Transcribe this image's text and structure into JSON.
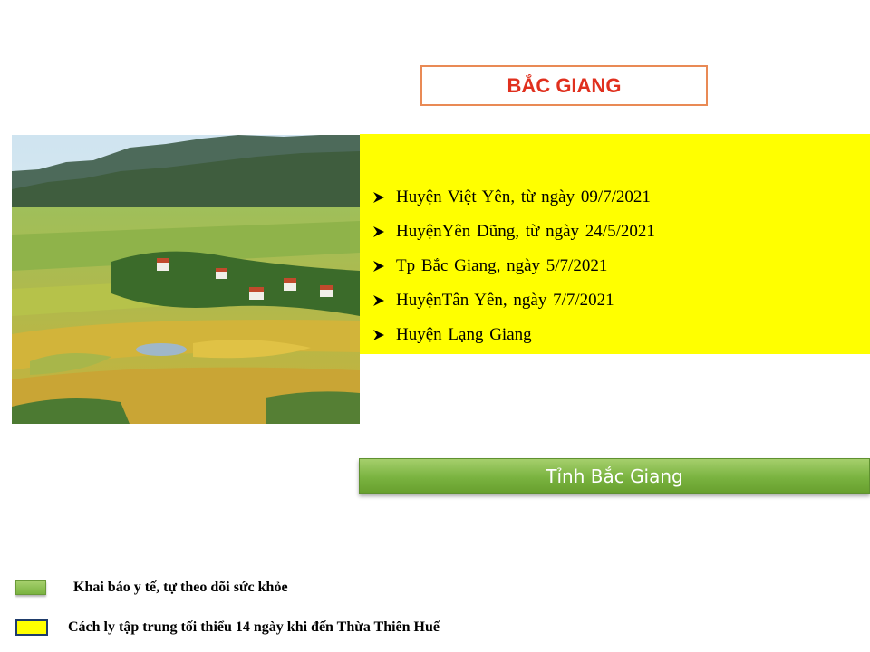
{
  "slide": {
    "title": "BẮC GIANG",
    "districts": [
      {
        "label": "Huyện  Việt Yên,  từ ngày  09/7/2021"
      },
      {
        "label": "HuyệnYên  Dũng,   từ ngày  24/5/2021"
      },
      {
        "label": "Tp Bắc Giang,  ngày  5/7/2021"
      },
      {
        "label": "HuyệnTân  Yên,  ngày  7/7/2021"
      },
      {
        "label": "Huyện   Lạng  Giang"
      }
    ],
    "province_bar_label": "Tỉnh Bắc Giang",
    "legend": [
      {
        "label": "Khai báo y tế, tự theo dõi sức khỏe",
        "color": "#8dc153"
      },
      {
        "label": "Cách ly tập trung  tối thiểu 14  ngày khi đến Thừa Thiên Huế",
        "color": "#ffff00"
      }
    ]
  },
  "colors": {
    "title_text": "#e0301e",
    "title_border": "#e98a55",
    "panel": "#ffff00",
    "bar": "#7ab340"
  },
  "icons": {
    "list_bullet": "arrow-bullet-icon"
  }
}
